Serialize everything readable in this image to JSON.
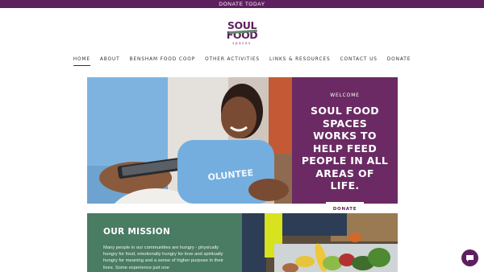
{
  "topbar": {
    "label": "DONATE TODAY"
  },
  "logo": {
    "line1": "SOUL",
    "line2": "FOOD",
    "line3": "spaces"
  },
  "nav": {
    "items": [
      {
        "label": "HOME"
      },
      {
        "label": "ABOUT"
      },
      {
        "label": "BENSHAM FOOD COOP"
      },
      {
        "label": "OTHER ACTIVITIES"
      },
      {
        "label": "LINKS & RESOURCES"
      },
      {
        "label": "CONTACT US"
      },
      {
        "label": "DONATE"
      }
    ],
    "active": "HOME"
  },
  "hero": {
    "eyebrow": "WELCOME",
    "heading": "SOUL FOOD SPACES WORKS TO HELP FEED PEOPLE IN ALL AREAS OF LIFE.",
    "button": "DONATE",
    "shirt_text": "OLUNTEE"
  },
  "mission": {
    "heading": "OUR MISSION",
    "body": "Many people in our communities are hungry - physically hungry for food, emotionally hungry for love and spiritually hungry for meaning and a sense of higher purpose in their lives. Some experience just one"
  },
  "colors": {
    "brand_purple": "#5e1f5f",
    "hero_panel": "#6b2a63",
    "mission_green": "#4a7c63",
    "logo_green": "#5f8a63"
  },
  "icons": {
    "chat": "chat-bubble-icon"
  }
}
